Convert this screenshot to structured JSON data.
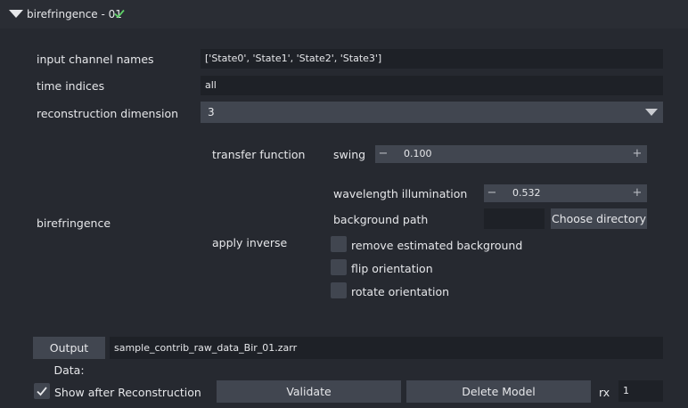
{
  "header": {
    "title": "birefringence - 01"
  },
  "form": {
    "input_channel_names": {
      "label": "input channel names",
      "value": "['State0', 'State1', 'State2', 'State3']"
    },
    "time_indices": {
      "label": "time indices",
      "value": "all"
    },
    "reconstruction_dimension": {
      "label": "reconstruction dimension",
      "value": "3"
    },
    "birefringence": {
      "label": "birefringence",
      "transfer_function": {
        "label": "transfer function",
        "swing": {
          "label": "swing",
          "value": "0.100"
        }
      },
      "apply_inverse": {
        "label": "apply inverse",
        "wavelength": {
          "label": "wavelength illumination",
          "value": "0.532"
        },
        "background_path": {
          "label": "background path",
          "value": "",
          "button_label": "Choose directory"
        },
        "remove_estimated_background": {
          "label": "remove estimated background",
          "checked": false
        },
        "flip_orientation": {
          "label": "flip orientation",
          "checked": false
        },
        "rotate_orientation": {
          "label": "rotate orientation",
          "checked": false
        }
      }
    }
  },
  "output": {
    "button_label": "Output Data:",
    "value": "sample_contrib_raw_data_Bir_01.zarr"
  },
  "footer": {
    "show_after": {
      "label": "Show after Reconstruction",
      "checked": true
    },
    "validate_label": "Validate",
    "delete_label": "Delete Model",
    "rx_label": "rx",
    "rx_value": "1"
  },
  "colors": {
    "background": "#262930",
    "control": "#414650",
    "field": "#1e2127",
    "accent_check": "#5fd068"
  }
}
